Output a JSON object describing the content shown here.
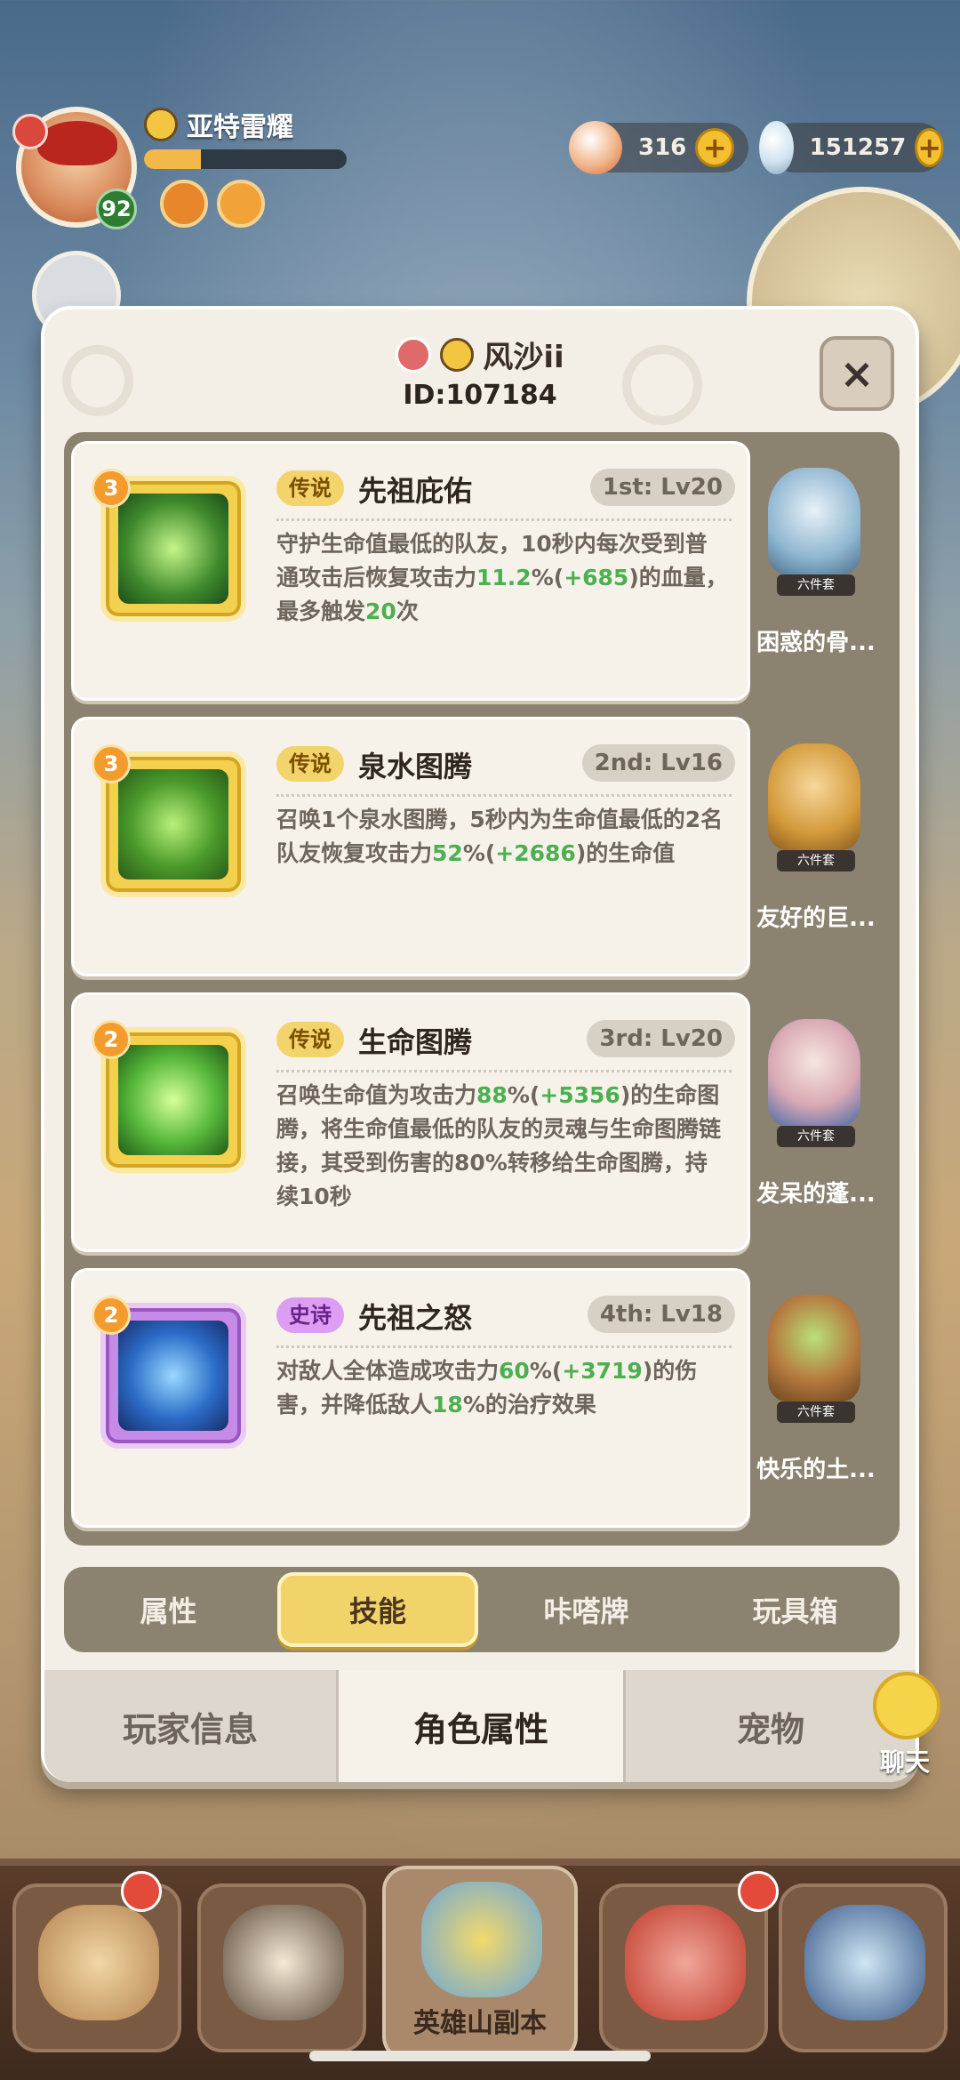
{
  "hud": {
    "player_name": "亚特雷耀",
    "level": "92",
    "xp_fraction": 0.28,
    "currency1": "316",
    "currency2": "151257",
    "plus": "+"
  },
  "modal": {
    "player_name": "风沙ii",
    "player_id": "ID:107184",
    "close": "×"
  },
  "skills": [
    {
      "badge": "3",
      "rarity": "传说",
      "name": "先祖庇佑",
      "level": "1st: Lv20",
      "desc_parts": [
        "守护生命值最低的队友，10秒内每次受到普通攻击后恢复攻击力",
        "11.2",
        "%(",
        "+685",
        ")的血量，最多触发",
        "20",
        "次"
      ],
      "pet_tag": "六件套",
      "pet_name": "困惑的骨..."
    },
    {
      "badge": "3",
      "rarity": "传说",
      "name": "泉水图腾",
      "level": "2nd: Lv16",
      "desc_parts": [
        "召唤1个泉水图腾，5秒内为生命值最低的2名队友恢复攻击力",
        "52",
        "%(",
        "+2686",
        ")的生命值"
      ],
      "pet_tag": "六件套",
      "pet_name": "友好的巨..."
    },
    {
      "badge": "2",
      "rarity": "传说",
      "name": "生命图腾",
      "level": "3rd: Lv20",
      "desc_parts": [
        "召唤生命值为攻击力",
        "88",
        "%(",
        "+5356",
        ")的生命图腾，将生命值最低的队友的灵魂与生命图腾链接，其受到伤害的80%转移给生命图腾，持续10秒"
      ],
      "pet_tag": "六件套",
      "pet_name": "发呆的蓬..."
    },
    {
      "badge": "2",
      "rarity": "史诗",
      "name": "先祖之怒",
      "level": "4th: Lv18",
      "desc_parts": [
        "对敌人全体造成攻击力",
        "60",
        "%(",
        "+3719",
        ")的伤害，并降低敌人",
        "18",
        "%的治疗效果"
      ],
      "pet_tag": "六件套",
      "pet_name": "快乐的土..."
    }
  ],
  "subtabs": [
    "属性",
    "技能",
    "咔嗒牌",
    "玩具箱"
  ],
  "bottom_tabs": [
    "玩家信息",
    "角色属性",
    "宠物"
  ],
  "chat_label": "聊天",
  "nav": {
    "center_label": "英雄山副本"
  }
}
